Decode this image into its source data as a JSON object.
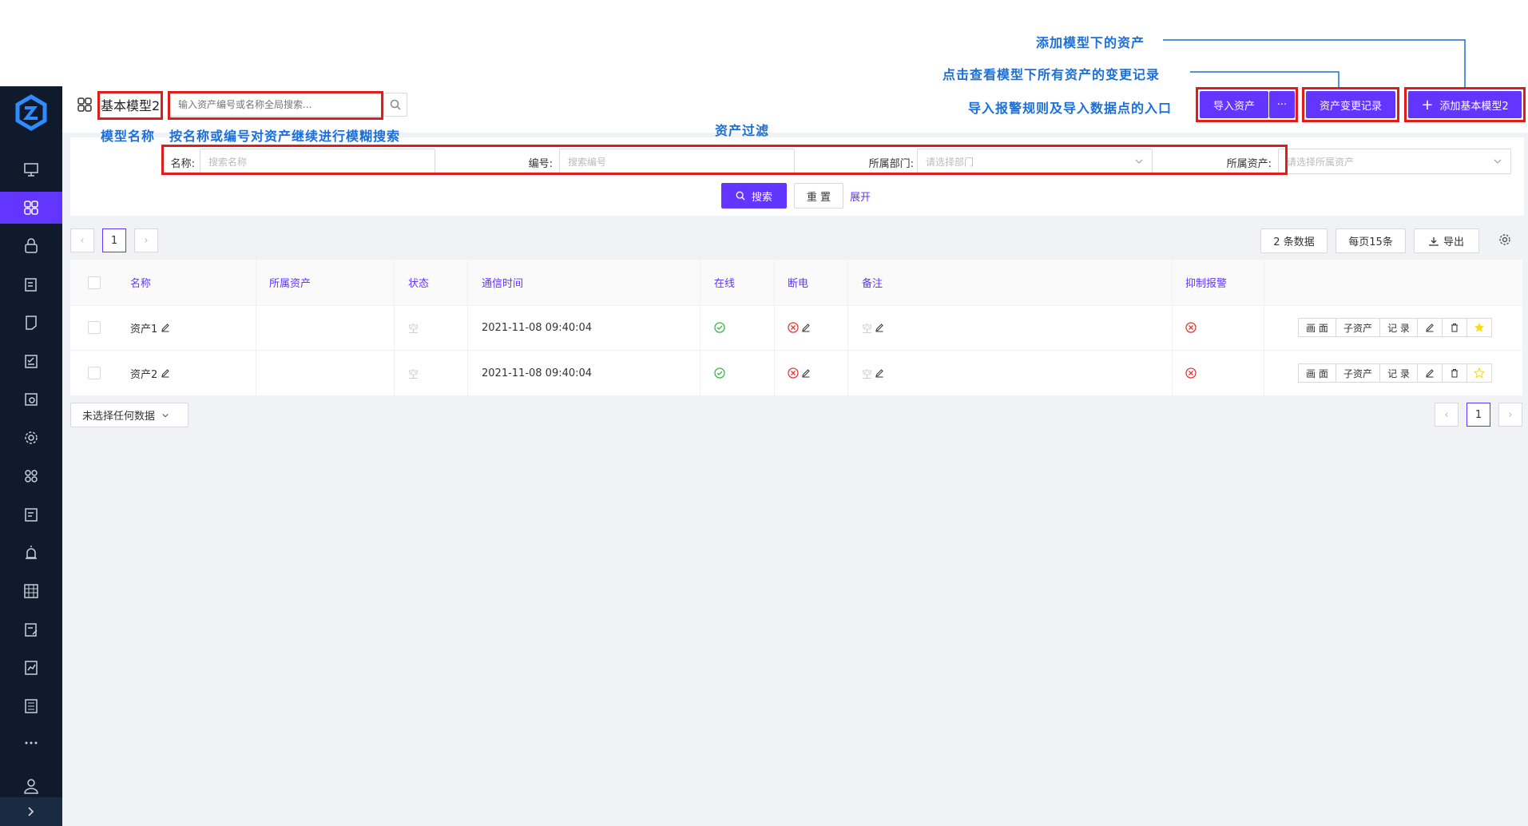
{
  "annotations": {
    "add_assets": "添加模型下的资产",
    "change_log": "点击查看模型下所有资产的变更记录",
    "import_entry": "导入报警规则及导入数据点的入口",
    "model_name": "模型名称",
    "fuzzy_search": "按名称或编号对资产继续进行模糊搜索",
    "asset_filter": "资产过滤"
  },
  "header": {
    "title": "基本模型2",
    "search_placeholder": "输入资产编号或名称全局搜索...",
    "import_label": "导入资产",
    "more_label": "···",
    "change_log_label": "资产变更记录",
    "add_label": "添加基本模型2",
    "add_plus": "+"
  },
  "filters": {
    "name_label": "名称:",
    "name_placeholder": "搜索名称",
    "code_label": "编号:",
    "code_placeholder": "搜索编号",
    "dept_label": "所属部门:",
    "dept_placeholder": "请选择部门",
    "asset_label": "所属资产:",
    "asset_placeholder": "请选择所属资产",
    "search_label": "搜索",
    "reset_label": "重 置",
    "expand_label": "展开"
  },
  "toolbar": {
    "page_current": "1",
    "count_label": "2 条数据",
    "per_page_label": "每页15条",
    "export_label": "导出"
  },
  "table": {
    "columns": [
      "名称",
      "所属资产",
      "状态",
      "通信时间",
      "在线",
      "断电",
      "备注",
      "抑制报警"
    ],
    "rows": [
      {
        "name": "资产1",
        "parent": "",
        "status": "空",
        "time": "2021-11-08 09:40:04",
        "remark": "空",
        "starred": true
      },
      {
        "name": "资产2",
        "parent": "",
        "status": "空",
        "time": "2021-11-08 09:40:04",
        "remark": "空",
        "starred": false
      }
    ],
    "actions": {
      "screen": "画 面",
      "sub": "子资产",
      "record": "记 录"
    }
  },
  "footer": {
    "selection_label": "未选择任何数据",
    "page_current": "1"
  },
  "colors": {
    "primary": "#6236ff",
    "sidebar": "#0f1b2c",
    "annotation": "#1a6fd8",
    "highlight": "#e01d1d",
    "online": "#3bb54a",
    "offline": "#e53935",
    "star": "#fadb14"
  }
}
